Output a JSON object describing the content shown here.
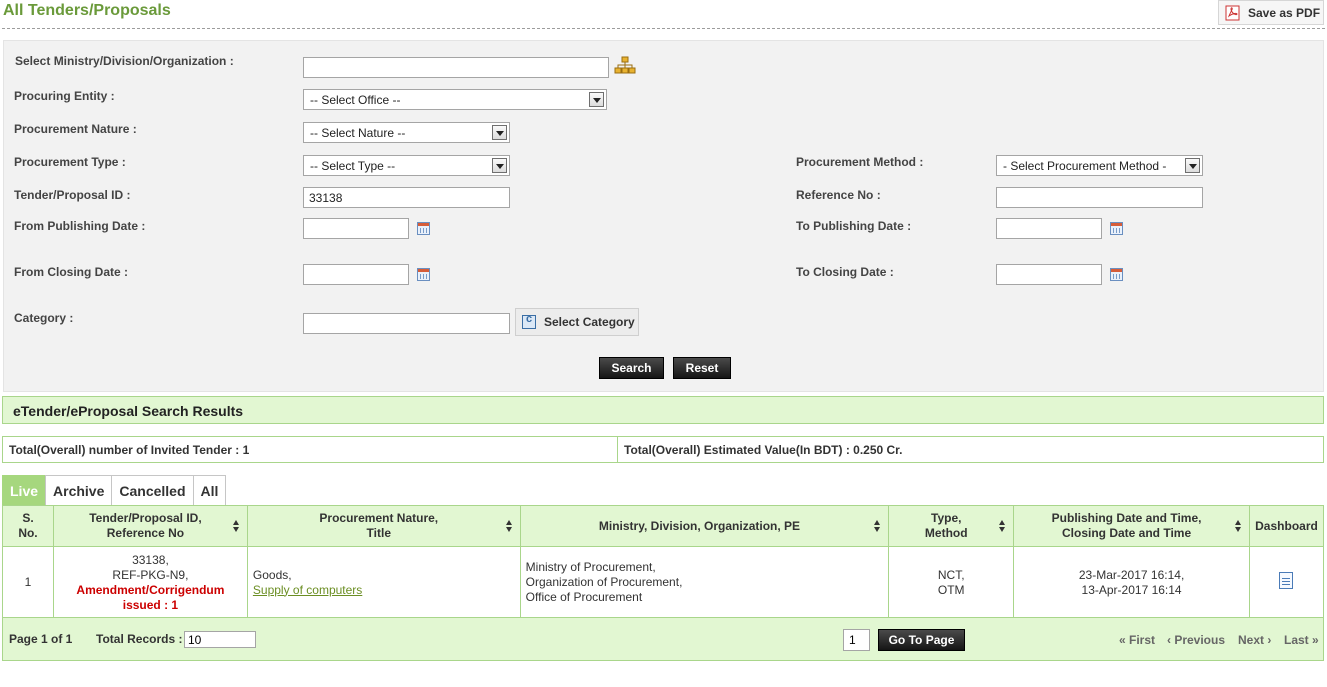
{
  "page": {
    "title": "All Tenders/Proposals",
    "save_pdf": "Save as PDF"
  },
  "form": {
    "ministry_label": "Select Ministry/Division/Organization :",
    "ministry_value": "",
    "procuring_entity_label": "Procuring Entity :",
    "procuring_entity_value": "-- Select Office --",
    "nature_label": "Procurement Nature :",
    "nature_value": "-- Select Nature --",
    "type_label": "Procurement Type :",
    "type_value": "-- Select Type --",
    "method_label": "Procurement Method :",
    "method_value": "- Select Procurement Method -",
    "tender_id_label": "Tender/Proposal ID :",
    "tender_id_value": "33138",
    "reference_label": "Reference No :",
    "reference_value": "",
    "from_pub_label": "From Publishing Date :",
    "to_pub_label": "To Publishing Date :",
    "from_close_label": "From Closing Date :",
    "to_close_label": "To Closing Date :",
    "category_label": "Category :",
    "category_value": "",
    "select_category": "Select Category",
    "search": "Search",
    "reset": "Reset"
  },
  "results": {
    "header": "eTender/eProposal Search Results",
    "total_tenders": "Total(Overall) number of Invited Tender : 1",
    "total_value": "Total(Overall) Estimated Value(In BDT) : 0.250 Cr.",
    "tabs": [
      "Live",
      "Archive",
      "Cancelled",
      "All"
    ],
    "columns": {
      "sno": [
        "S.",
        "No."
      ],
      "tender": [
        "Tender/Proposal ID,",
        "Reference No"
      ],
      "nature": [
        "Procurement Nature,",
        "Title"
      ],
      "ministry": "Ministry, Division, Organization, PE",
      "type": [
        "Type,",
        "Method"
      ],
      "dates": [
        "Publishing Date and Time,",
        "Closing Date and Time"
      ],
      "dashboard": "Dashboard"
    },
    "rows": [
      {
        "sno": "1",
        "tender_id": "33138,",
        "ref_no": "REF-PKG-N9,",
        "amend1": "Amendment/Corrigendum",
        "amend2": "issued : 1",
        "nature": "Goods,",
        "title": "Supply of computers",
        "ministry": "Ministry of Procurement,",
        "organization": "Organization of Procurement,",
        "office": "Office of Procurement",
        "type": "NCT,",
        "method": "OTM",
        "published": "23-Mar-2017 16:14,",
        "closing": "13-Apr-2017 16:14"
      }
    ]
  },
  "pager": {
    "page_info": "Page 1 of 1",
    "total_records_label": "Total Records :",
    "total_records_value": "10",
    "page_input": "1",
    "go_to_page": "Go To Page",
    "first": "« First",
    "previous": "‹ Previous",
    "next": "Next ›",
    "last": "Last »"
  }
}
